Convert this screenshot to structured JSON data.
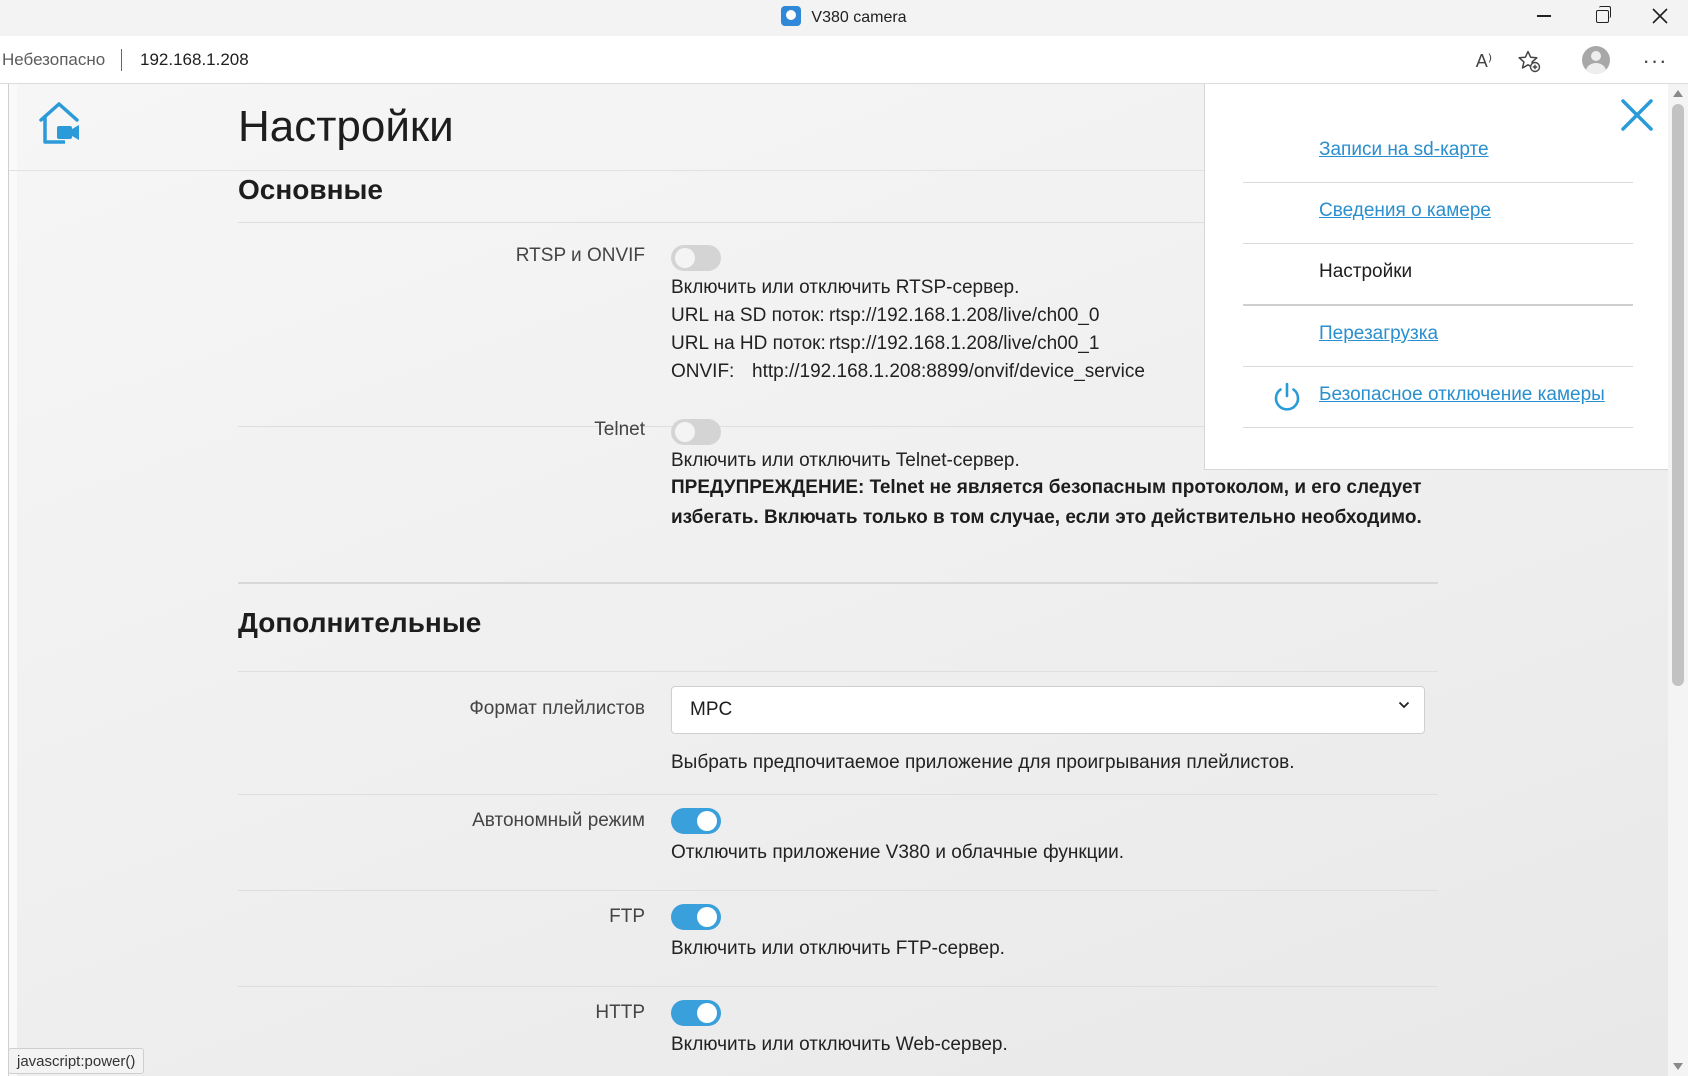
{
  "window": {
    "title": "V380 camera",
    "favicon": "camera-app-icon",
    "minimize_icon": "minimize-icon",
    "maximize_icon": "restore-icon",
    "close_icon": "close-icon"
  },
  "addressbar": {
    "security_label": "Небезопасно",
    "url": "192.168.1.208",
    "read_aloud_glyph": "A⁾",
    "favorites_icon": "star-add-icon",
    "profile_icon": "profile-icon",
    "more_glyph": "···"
  },
  "page": {
    "title": "Настройки",
    "accent_color": "#3aa0dc",
    "sections": {
      "basic": {
        "title": "Основные",
        "rtsp": {
          "label": "RTSP и ONVIF",
          "enabled": false,
          "desc": "Включить или отключить RTSP-сервер.",
          "sd_label": "URL на SD поток:",
          "sd_url": "rtsp://192.168.1.208/live/ch00_0",
          "hd_label": "URL на HD поток:",
          "hd_url": "rtsp://192.168.1.208/live/ch00_1",
          "onvif_label": "ONVIF:",
          "onvif_url": "http://192.168.1.208:8899/onvif/device_service"
        },
        "telnet": {
          "label": "Telnet",
          "enabled": false,
          "desc": "Включить или отключить Telnet-сервер.",
          "warning_line1": "ПРЕДУПРЕЖДЕНИЕ: Telnet не является безопасным протоколом, и его следует",
          "warning_line2": "избегать. Включать только в том случае, если это действительно необходимо."
        }
      },
      "advanced": {
        "title": "Дополнительные",
        "playlist": {
          "label": "Формат плейлистов",
          "selected": "MPC",
          "desc": "Выбрать предпочитаемое приложение для проигрывания плейлистов."
        },
        "autonomous": {
          "label": "Автономный режим",
          "enabled": true,
          "desc": "Отключить приложение V380 и облачные функции."
        },
        "ftp": {
          "label": "FTP",
          "enabled": true,
          "desc": "Включить или отключить FTP-сервер."
        },
        "http": {
          "label": "HTTP",
          "enabled": true,
          "desc": "Включить или отключить Web-сервер."
        }
      }
    }
  },
  "menu": {
    "items": [
      {
        "label": "Записи на sd-карте"
      },
      {
        "label": "Сведения о камере"
      },
      {
        "label": "Настройки"
      },
      {
        "label": "Перезагрузка"
      },
      {
        "label": "Безопасное отключение камеры"
      }
    ]
  },
  "status_bar": {
    "text": "javascript:power()"
  }
}
